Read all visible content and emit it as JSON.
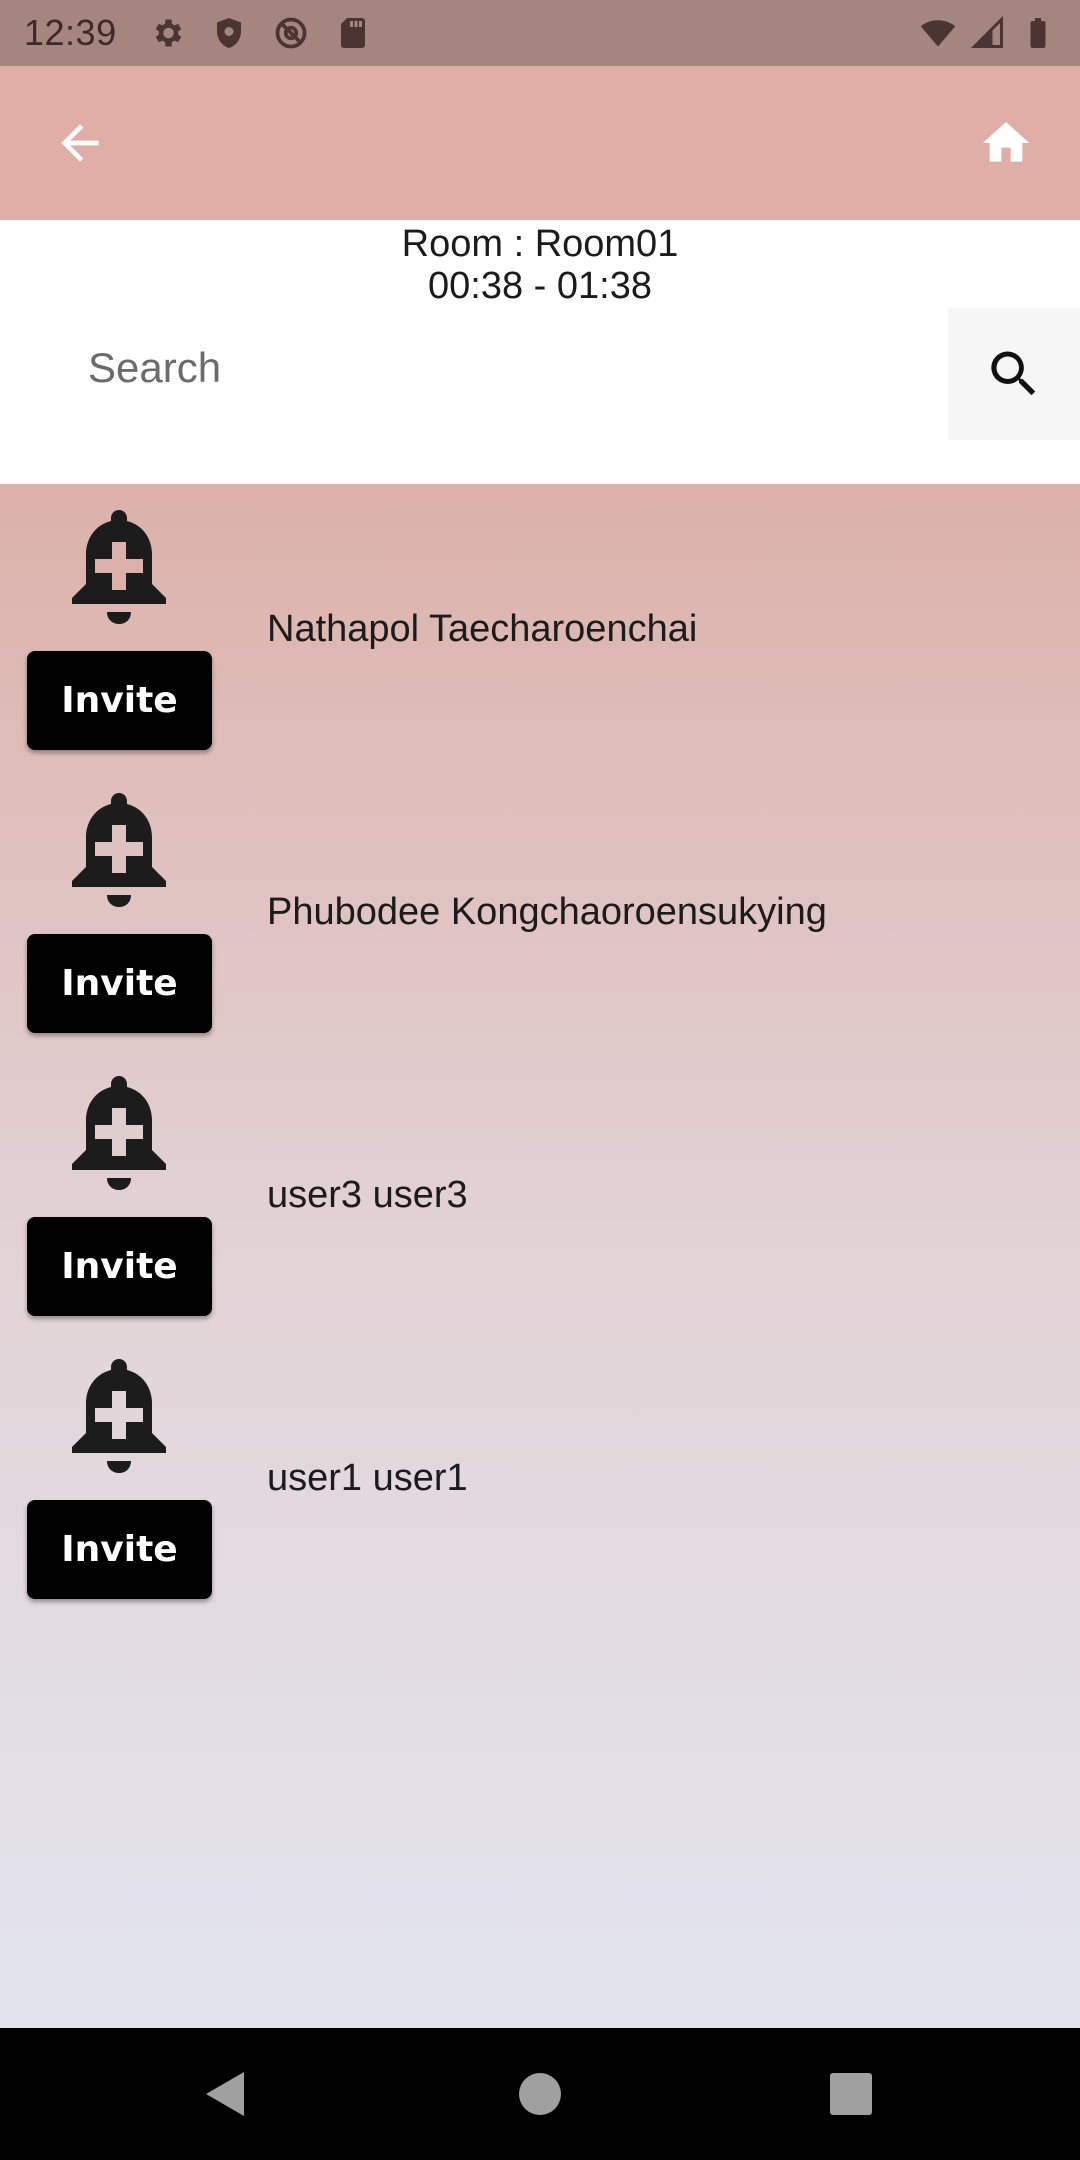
{
  "status_bar": {
    "time": "12:39",
    "left_icons": [
      "settings-icon",
      "shield-icon",
      "at-sign-icon",
      "sd-card-icon"
    ],
    "right_icons": [
      "wifi-icon",
      "signal-icon",
      "battery-icon"
    ]
  },
  "app_bar": {
    "back_icon": "arrow-back-icon",
    "home_icon": "home-icon",
    "background": "#dfaea6"
  },
  "room": {
    "title": "Room : Room01",
    "time": "00:38 - 01:38"
  },
  "search": {
    "placeholder": "Search",
    "value": "",
    "icon": "search-icon"
  },
  "users": [
    {
      "name": "Nathapol Taecharoenchai",
      "invite_label": "Invite",
      "icon": "bell-plus-icon"
    },
    {
      "name": "Phubodee Kongchaoroensukying",
      "invite_label": "Invite",
      "icon": "bell-plus-icon"
    },
    {
      "name": "user3 user3",
      "invite_label": "Invite",
      "icon": "bell-plus-icon"
    },
    {
      "name": "user1 user1",
      "invite_label": "Invite",
      "icon": "bell-plus-icon"
    }
  ],
  "nav_bar": {
    "buttons": [
      "back-triangle-icon",
      "home-circle-icon",
      "recents-square-icon"
    ]
  }
}
